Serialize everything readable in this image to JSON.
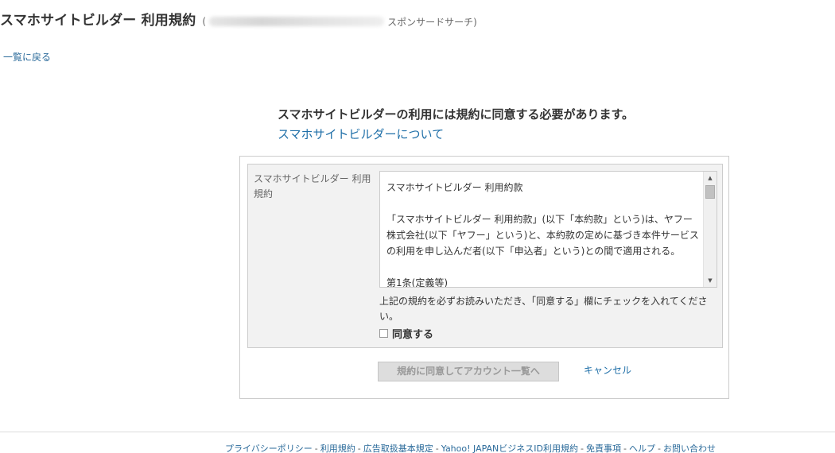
{
  "header": {
    "title": "スマホサイトビルダー 利用規約",
    "subtitle_open": "(",
    "subtitle_suffix": "スポンサードサーチ)"
  },
  "back_link": "一覧に戻る",
  "notice": "スマホサイトビルダーの利用には規約に同意する必要があります。",
  "about_link": "スマホサイトビルダーについて",
  "form": {
    "terms_label": "スマホサイトビルダー 利用規約",
    "terms_paragraphs": [
      "スマホサイトビルダー 利用約款",
      "「スマホサイトビルダー 利用約款」(以下「本約款」という)は、ヤフー株式会社(以下「ヤフー」という)と、本約款の定めに基づき本件サービスの利用を申し込んだ者(以下「申込者」という)との間で適用される。",
      "第1条(定義等)"
    ],
    "instruction": "上記の規約を必ずお読みいただき、「同意する」欄にチェックを入れてください。",
    "agree_checkbox_label": "同意する",
    "agree_checked": false,
    "submit_label": "規約に同意してアカウント一覧へ",
    "cancel_label": "キャンセル"
  },
  "footer": {
    "links": [
      "プライバシーポリシー",
      "利用規約",
      "広告取扱基本規定",
      "Yahoo! JAPANビジネスID利用規約",
      "免責事項",
      "ヘルプ",
      "お問い合わせ"
    ],
    "separator": "-"
  },
  "icons": {
    "scroll_up": "scroll-up-arrow",
    "scroll_down": "scroll-down-arrow"
  }
}
